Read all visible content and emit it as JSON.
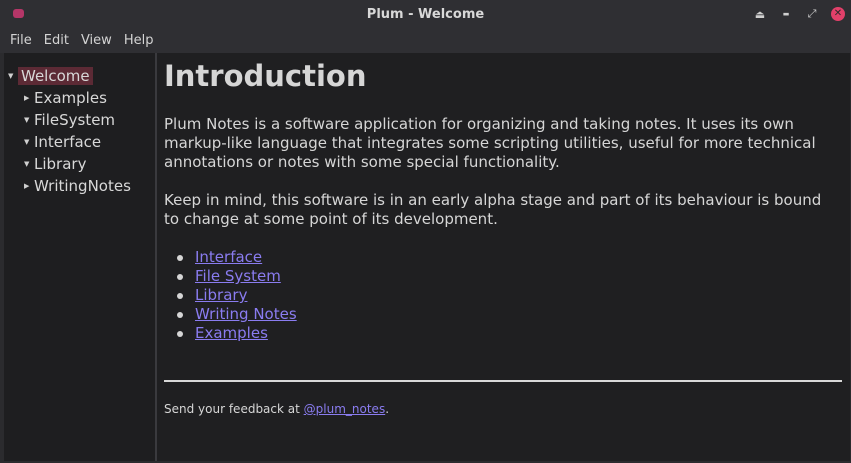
{
  "window": {
    "title": "Plum - Welcome",
    "controls": [
      {
        "name": "keep-above-icon",
        "glyph": "⏏"
      },
      {
        "name": "minimize-icon",
        "glyph": "▬"
      },
      {
        "name": "restore-icon",
        "glyph": "⤢"
      },
      {
        "name": "close-icon",
        "glyph": "✕"
      }
    ]
  },
  "menu": [
    "File",
    "Edit",
    "View",
    "Help"
  ],
  "sidebar": {
    "items": [
      {
        "label": "Welcome",
        "expanded": true,
        "selected": true
      },
      {
        "label": "Examples",
        "expanded": false
      },
      {
        "label": "FileSystem",
        "expanded": true
      },
      {
        "label": "Interface",
        "expanded": true
      },
      {
        "label": "Library",
        "expanded": true
      },
      {
        "label": "WritingNotes",
        "expanded": false
      }
    ]
  },
  "main": {
    "heading": "Introduction",
    "paragraph1": "Plum Notes is a software application for organizing and taking notes. It uses its own markup-like language that integrates some scripting utilities, useful for more technical annotations or notes with some special functionality.",
    "paragraph2": "Keep in mind, this software is in an early alpha stage and part of its behaviour is bound to change at some point of its development.",
    "links": [
      "Interface",
      "File System",
      "Library",
      "Writing Notes",
      "Examples"
    ],
    "footer_text": "Send your feedback at ",
    "footer_link": "@plum_notes",
    "footer_end": "."
  },
  "colors": {
    "accent": "#e2406a",
    "selection": "#5c2a35",
    "link": "#8a7cf0",
    "background": "#1f1f21"
  }
}
